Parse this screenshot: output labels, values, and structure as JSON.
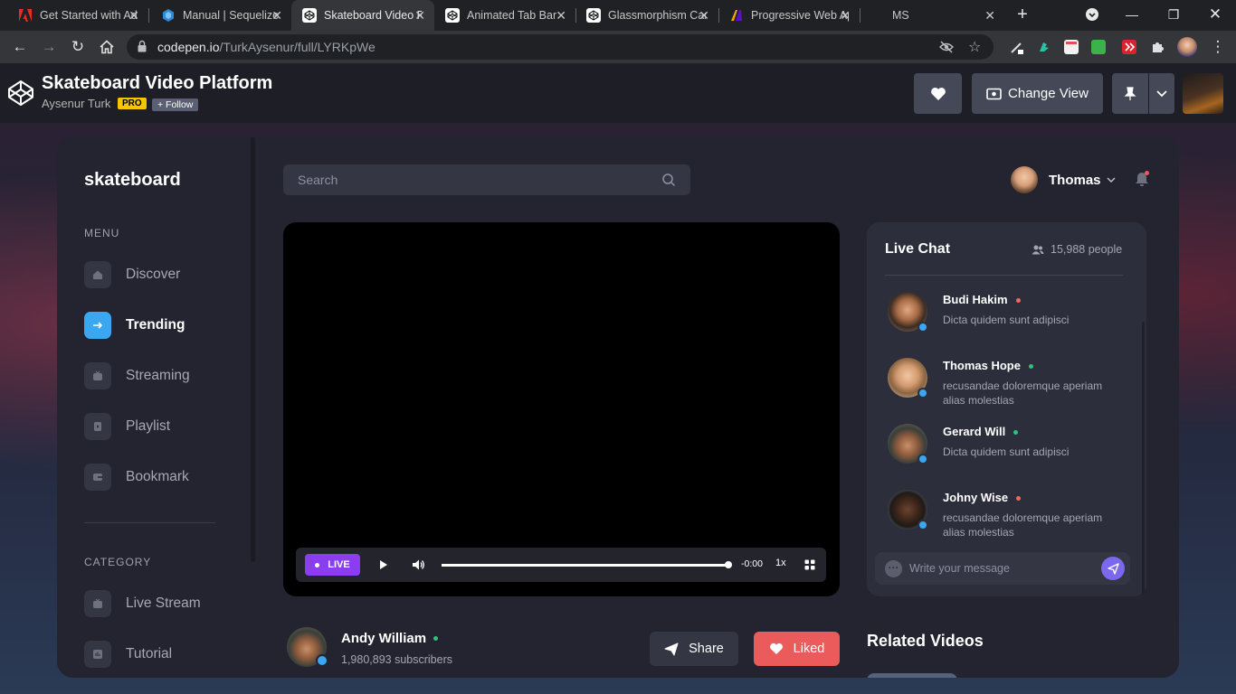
{
  "browser": {
    "tabs": [
      {
        "title": "Get Started with Ad",
        "icon": "adobe-icon",
        "icon_color": "#e0301e"
      },
      {
        "title": "Manual | Sequelize",
        "icon": "sequelize-icon",
        "icon_color": "#2f8bd6"
      },
      {
        "title": "Skateboard Video Pl",
        "icon": "codepen-icon",
        "icon_color": "#ffffff"
      },
      {
        "title": "Animated Tab Bar",
        "icon": "codepen-icon",
        "icon_color": "#ffffff"
      },
      {
        "title": "Glassmorphism Card",
        "icon": "codepen-icon",
        "icon_color": "#ffffff"
      },
      {
        "title": "Progressive Web Ap",
        "icon": "pwa-icon",
        "icon_color": "#f4a300"
      },
      {
        "title": "MS",
        "icon": "",
        "icon_color": ""
      }
    ],
    "active_tab": 2,
    "url_host": "codepen.io",
    "url_path": "/TurkAysenur/full/LYRKpWe"
  },
  "codepen": {
    "title": "Skateboard Video Platform",
    "author": "Aysenur Turk",
    "pro_badge": "PRO",
    "follow_label": "+ Follow",
    "change_view_label": "Change View"
  },
  "app": {
    "brand": "skateboard",
    "menu_title": "MENU",
    "menu": [
      {
        "label": "Discover",
        "active": false
      },
      {
        "label": "Trending",
        "active": true
      },
      {
        "label": "Streaming",
        "active": false
      },
      {
        "label": "Playlist",
        "active": false
      },
      {
        "label": "Bookmark",
        "active": false
      }
    ],
    "category_title": "CATEGORY",
    "categories": [
      {
        "label": "Live Stream"
      },
      {
        "label": "Tutorial"
      }
    ],
    "search_placeholder": "Search",
    "user_name": "Thomas",
    "accent": "#3aa7f0"
  },
  "player": {
    "live_label": "LIVE",
    "time": "-0:00",
    "speed": "1x",
    "progress": 1.0
  },
  "chat": {
    "title": "Live Chat",
    "people_count": "15,988 people",
    "messages": [
      {
        "name": "Budi Hakim",
        "status": "offline",
        "status_color": "#f06a5a",
        "text": "Dicta quidem sunt adipisci"
      },
      {
        "name": "Thomas Hope",
        "status": "online",
        "status_color": "#2ec27e",
        "text": "recusandae doloremque aperiam alias molestias"
      },
      {
        "name": "Gerard Will",
        "status": "online",
        "status_color": "#2ec27e",
        "text": "Dicta quidem sunt adipisci"
      },
      {
        "name": "Johny Wise",
        "status": "offline",
        "status_color": "#f06a5a",
        "text": "recusandae doloremque aperiam alias molestias"
      }
    ],
    "input_placeholder": "Write your message"
  },
  "channel": {
    "name": "Andy William",
    "subscribers": "1,980,893 subscribers",
    "share_label": "Share",
    "liked_label": "Liked",
    "liked_color": "#ec5b5b"
  },
  "related_title": "Related Videos"
}
